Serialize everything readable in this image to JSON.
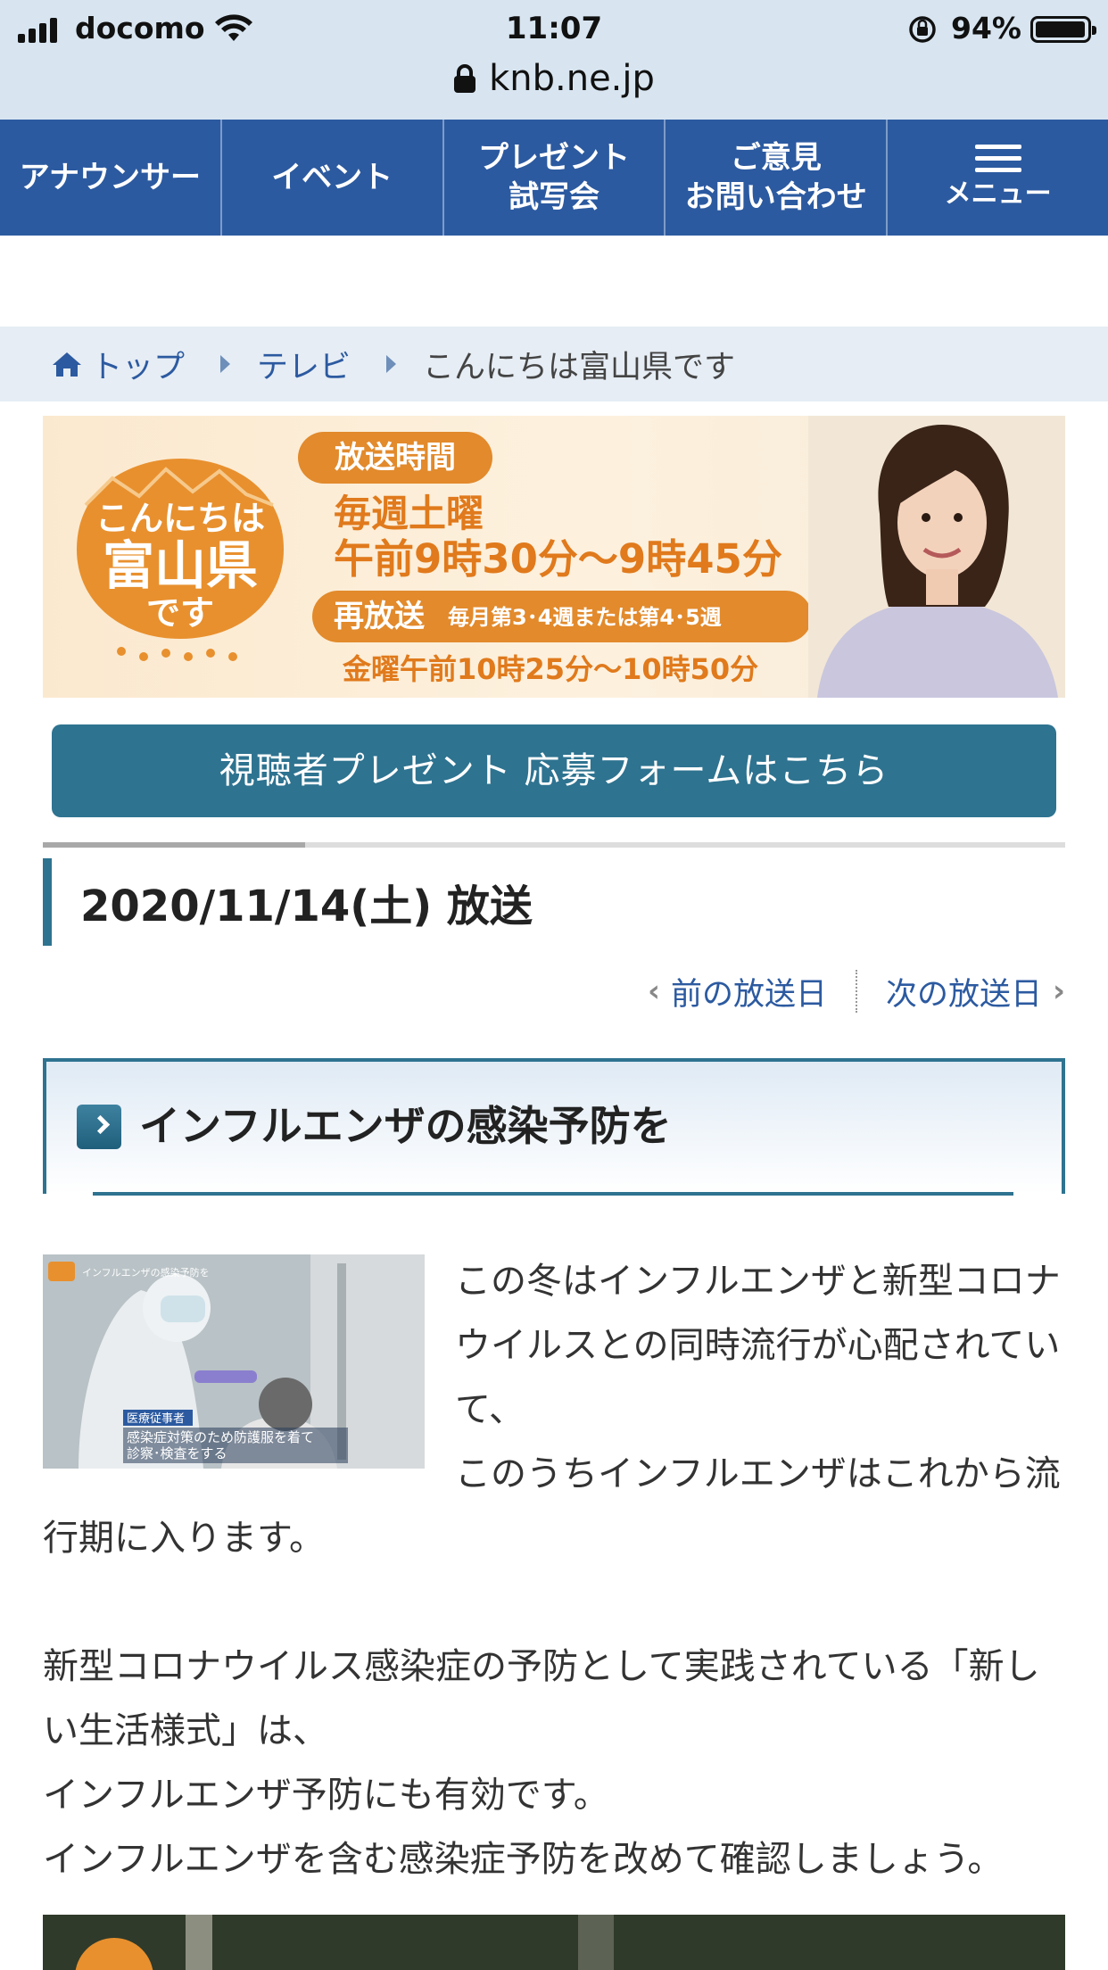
{
  "status_bar": {
    "carrier": "docomo",
    "time": "11:07",
    "battery": "94%"
  },
  "url_bar": {
    "domain": "knb.ne.jp"
  },
  "nav": {
    "items": [
      {
        "line1": "アナウンサー",
        "line2": ""
      },
      {
        "line1": "イベント",
        "line2": ""
      },
      {
        "line1": "プレゼント",
        "line2": "試写会"
      },
      {
        "line1": "ご意見",
        "line2": "お問い合わせ"
      }
    ],
    "menu_label": "メニュー"
  },
  "breadcrumb": {
    "items": [
      "トップ",
      "テレビ"
    ],
    "current": "こんにちは富山県です"
  },
  "banner": {
    "logo_line1": "こんにちは",
    "logo_line2": "富山県",
    "logo_line3": "です",
    "slot_label": "放送時間",
    "weekly": "毎週土曜",
    "time_main": "午前9時30分～9時45分",
    "rerun_label": "再放送",
    "rerun_note": "毎月第3･4週または第4･5週",
    "rerun_time": "金曜午前10時25分～10時50分"
  },
  "present_button": "視聴者プレゼント 応募フォームはこちら",
  "broadcast_date": "2020/11/14(土) 放送",
  "pager": {
    "prev": "前の放送日",
    "next": "次の放送日"
  },
  "topic": {
    "title": "インフルエンザの感染予防を"
  },
  "thumbnail": {
    "caption_tag": "医療従事者",
    "caption_line1": "感染症対策のため防護服を着て",
    "caption_line2": "診察･検査をする",
    "header_text": "インフルエンザの感染予防を"
  },
  "article": {
    "p1_a": "この冬はインフルエンザと新型コロナウイルスとの同時流行が心配されていて、",
    "p1_b": "このうちインフルエンザはこれから流行期に入ります。",
    "p2_a": "新型コロナウイルス感染症の予防として実践されている「新しい生活様式」は、",
    "p2_b": "インフルエンザ予防にも有効です。",
    "p2_c": "インフルエンザを含む感染症予防を改めて確認しましょう。"
  },
  "colors": {
    "nav_bg": "#2c5aa0",
    "accent_teal": "#2e7390",
    "banner_orange": "#e28a2c"
  }
}
